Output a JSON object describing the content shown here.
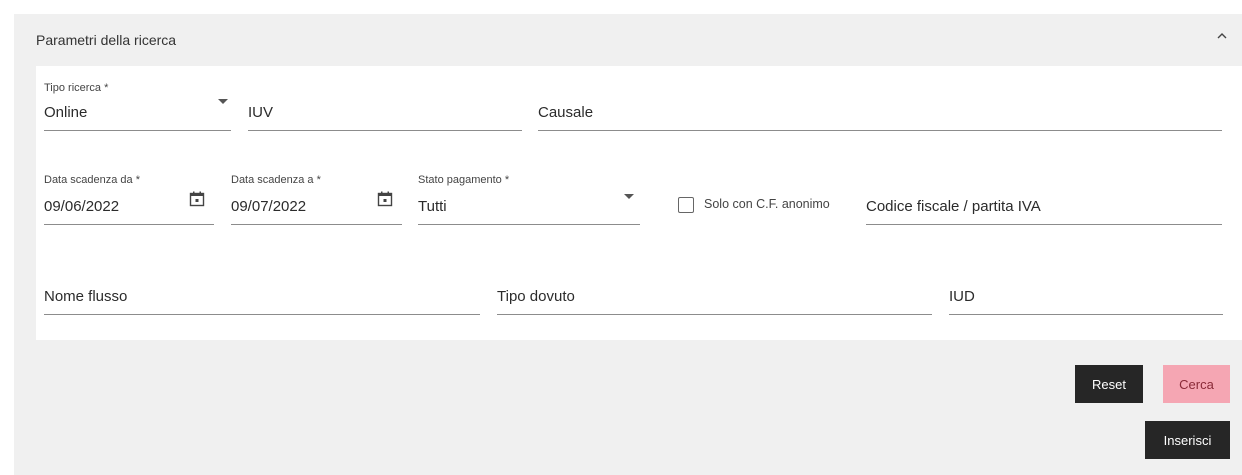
{
  "panel": {
    "title": "Parametri della ricerca"
  },
  "form": {
    "tipo_ricerca": {
      "label": "Tipo ricerca *",
      "value": "Online"
    },
    "iuv": {
      "placeholder": "IUV"
    },
    "causale": {
      "placeholder": "Causale"
    },
    "data_scadenza_da": {
      "label": "Data scadenza da *",
      "value": "09/06/2022"
    },
    "data_scadenza_a": {
      "label": "Data scadenza a *",
      "value": "09/07/2022"
    },
    "stato_pagamento": {
      "label": "Stato pagamento *",
      "value": "Tutti"
    },
    "solo_cf_anonimo": {
      "label": "Solo con C.F. anonimo",
      "checked": false
    },
    "codice_fiscale": {
      "placeholder": "Codice fiscale / partita IVA"
    },
    "nome_flusso": {
      "placeholder": "Nome flusso"
    },
    "tipo_dovuto": {
      "placeholder": "Tipo dovuto"
    },
    "iud": {
      "placeholder": "IUD"
    }
  },
  "actions": {
    "reset_label": "Reset",
    "cerca_label": "Cerca",
    "inserisci_label": "Inserisci"
  },
  "colors": {
    "panel_bg": "#f0f0f0",
    "dark_button": "#262626",
    "pink_button": "#f5a6b3"
  },
  "icons": {
    "collapse": "chevron-up-icon",
    "date": "calendar-icon",
    "select": "caret-down-icon"
  }
}
